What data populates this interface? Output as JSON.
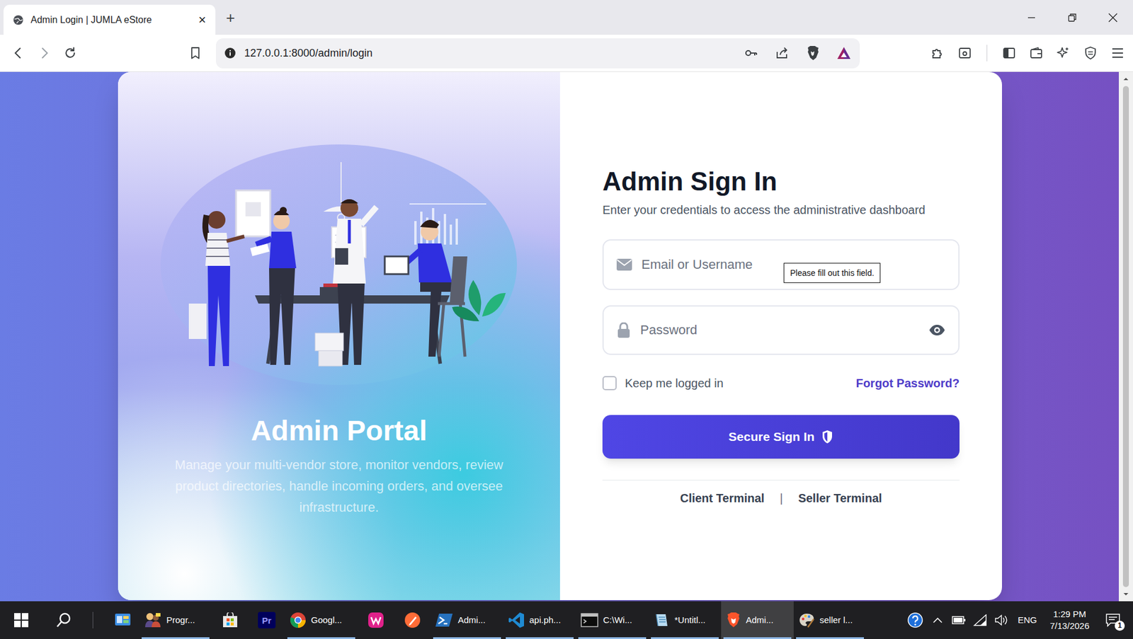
{
  "browser": {
    "tabs": [
      {
        "title": "Admin Login | JUMLA eStore",
        "close": "×",
        "selected": true
      }
    ],
    "new_tab": "+",
    "address": "127.0.0.1:8000/admin/login"
  },
  "portal": {
    "title": "Admin Portal",
    "description": "Manage your multi-vendor store, monitor vendors, review product directories, handle incoming orders, and oversee infrastructure."
  },
  "login": {
    "title": "Admin Sign In",
    "subtitle": "Enter your credentials to access the administrative dashboard",
    "email": {
      "placeholder": "Email or Username",
      "tooltip": "Please fill out this field."
    },
    "password": {
      "placeholder": "Password"
    },
    "remember": {
      "label": "Keep me logged in",
      "checked": false
    },
    "forgot": "Forgot Password?",
    "submit": "Secure Sign In",
    "links": [
      {
        "label": "Client Terminal"
      },
      {
        "label": "Seller Terminal"
      }
    ],
    "separator": "|"
  },
  "taskbar": {
    "apps": [
      {
        "running": false,
        "selected": false
      },
      {
        "label": "Progr...",
        "running": true,
        "selected": false
      },
      {
        "running": false,
        "selected": false
      },
      {
        "icon_text": "Pr",
        "running": false,
        "selected": false
      },
      {
        "label": "Googl...",
        "running": true,
        "selected": false
      },
      {
        "running": false,
        "selected": false
      },
      {
        "running": false,
        "selected": false
      },
      {
        "label": "Admi...",
        "running": true,
        "selected": false
      },
      {
        "label": "api.ph...",
        "running": true,
        "selected": false
      },
      {
        "label": "C:\\Wi...",
        "running": true,
        "selected": false
      },
      {
        "label": "*Untitl...",
        "running": true,
        "selected": false
      },
      {
        "label": "Admi...",
        "running": true,
        "selected": true
      },
      {
        "label": "seller l...",
        "running": true,
        "selected": false
      }
    ],
    "tray": {
      "language": "ENG",
      "time": "1:29 PM",
      "date": "7/13/2026",
      "notifications": "1"
    }
  }
}
